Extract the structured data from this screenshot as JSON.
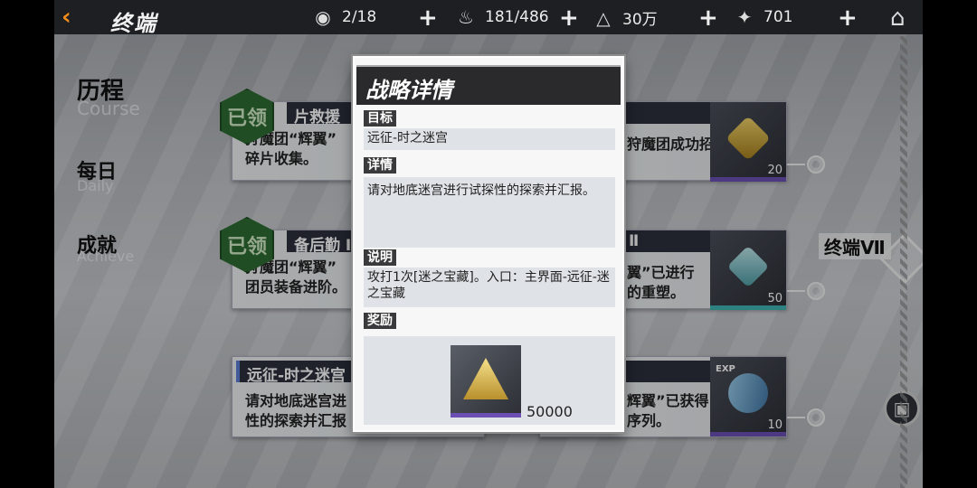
{
  "topbar": {
    "title": "终端",
    "resources": [
      {
        "icon": "eye-icon",
        "value": "2/18"
      },
      {
        "icon": "flame-icon",
        "value": "181/486"
      },
      {
        "icon": "pyramid-icon",
        "value": "30万"
      },
      {
        "icon": "star-icon",
        "value": "701"
      }
    ]
  },
  "menu": [
    {
      "cn": "历程",
      "en": "Course"
    },
    {
      "cn": "每日",
      "en": "Daily"
    },
    {
      "cn": "成就",
      "en": "Achieve"
    }
  ],
  "cards": [
    {
      "header": "片救援",
      "body1": "狩魔团“辉翼”",
      "body2": "碎片收集。",
      "claimed": "已领"
    },
    {
      "header": "备后勤 Ⅰ",
      "body1": "狩魔团“辉翼”",
      "body2": "团员装备进阶。",
      "claimed": "已领"
    },
    {
      "header": "远征-时之迷宫",
      "body1": "请对地底迷宫进",
      "body2": "性的探索并汇报"
    },
    {
      "header": "",
      "body1": "狩魔团成功招",
      "body2": "",
      "count": "20"
    },
    {
      "header": "Ⅱ",
      "body1": "翼”已进行",
      "body2": "的重塑。",
      "count": "50"
    },
    {
      "header": "",
      "body1": "辉翼”已获得",
      "body2": "序列。",
      "count": "10",
      "tag": "EXP"
    }
  ],
  "side": {
    "label": "终端Ⅶ"
  },
  "modal": {
    "title": "战略详情",
    "target_label": "目标",
    "target_value": "远征-时之迷宫",
    "detail_label": "详情",
    "detail_value": "请对地底迷宫进行试探性的探索并汇报。",
    "note_label": "说明",
    "note_value": "攻打1次[迷之宝藏]。入口：主界面-远征-迷之宝藏",
    "reward_label": "奖励",
    "reward_count": "50000"
  }
}
